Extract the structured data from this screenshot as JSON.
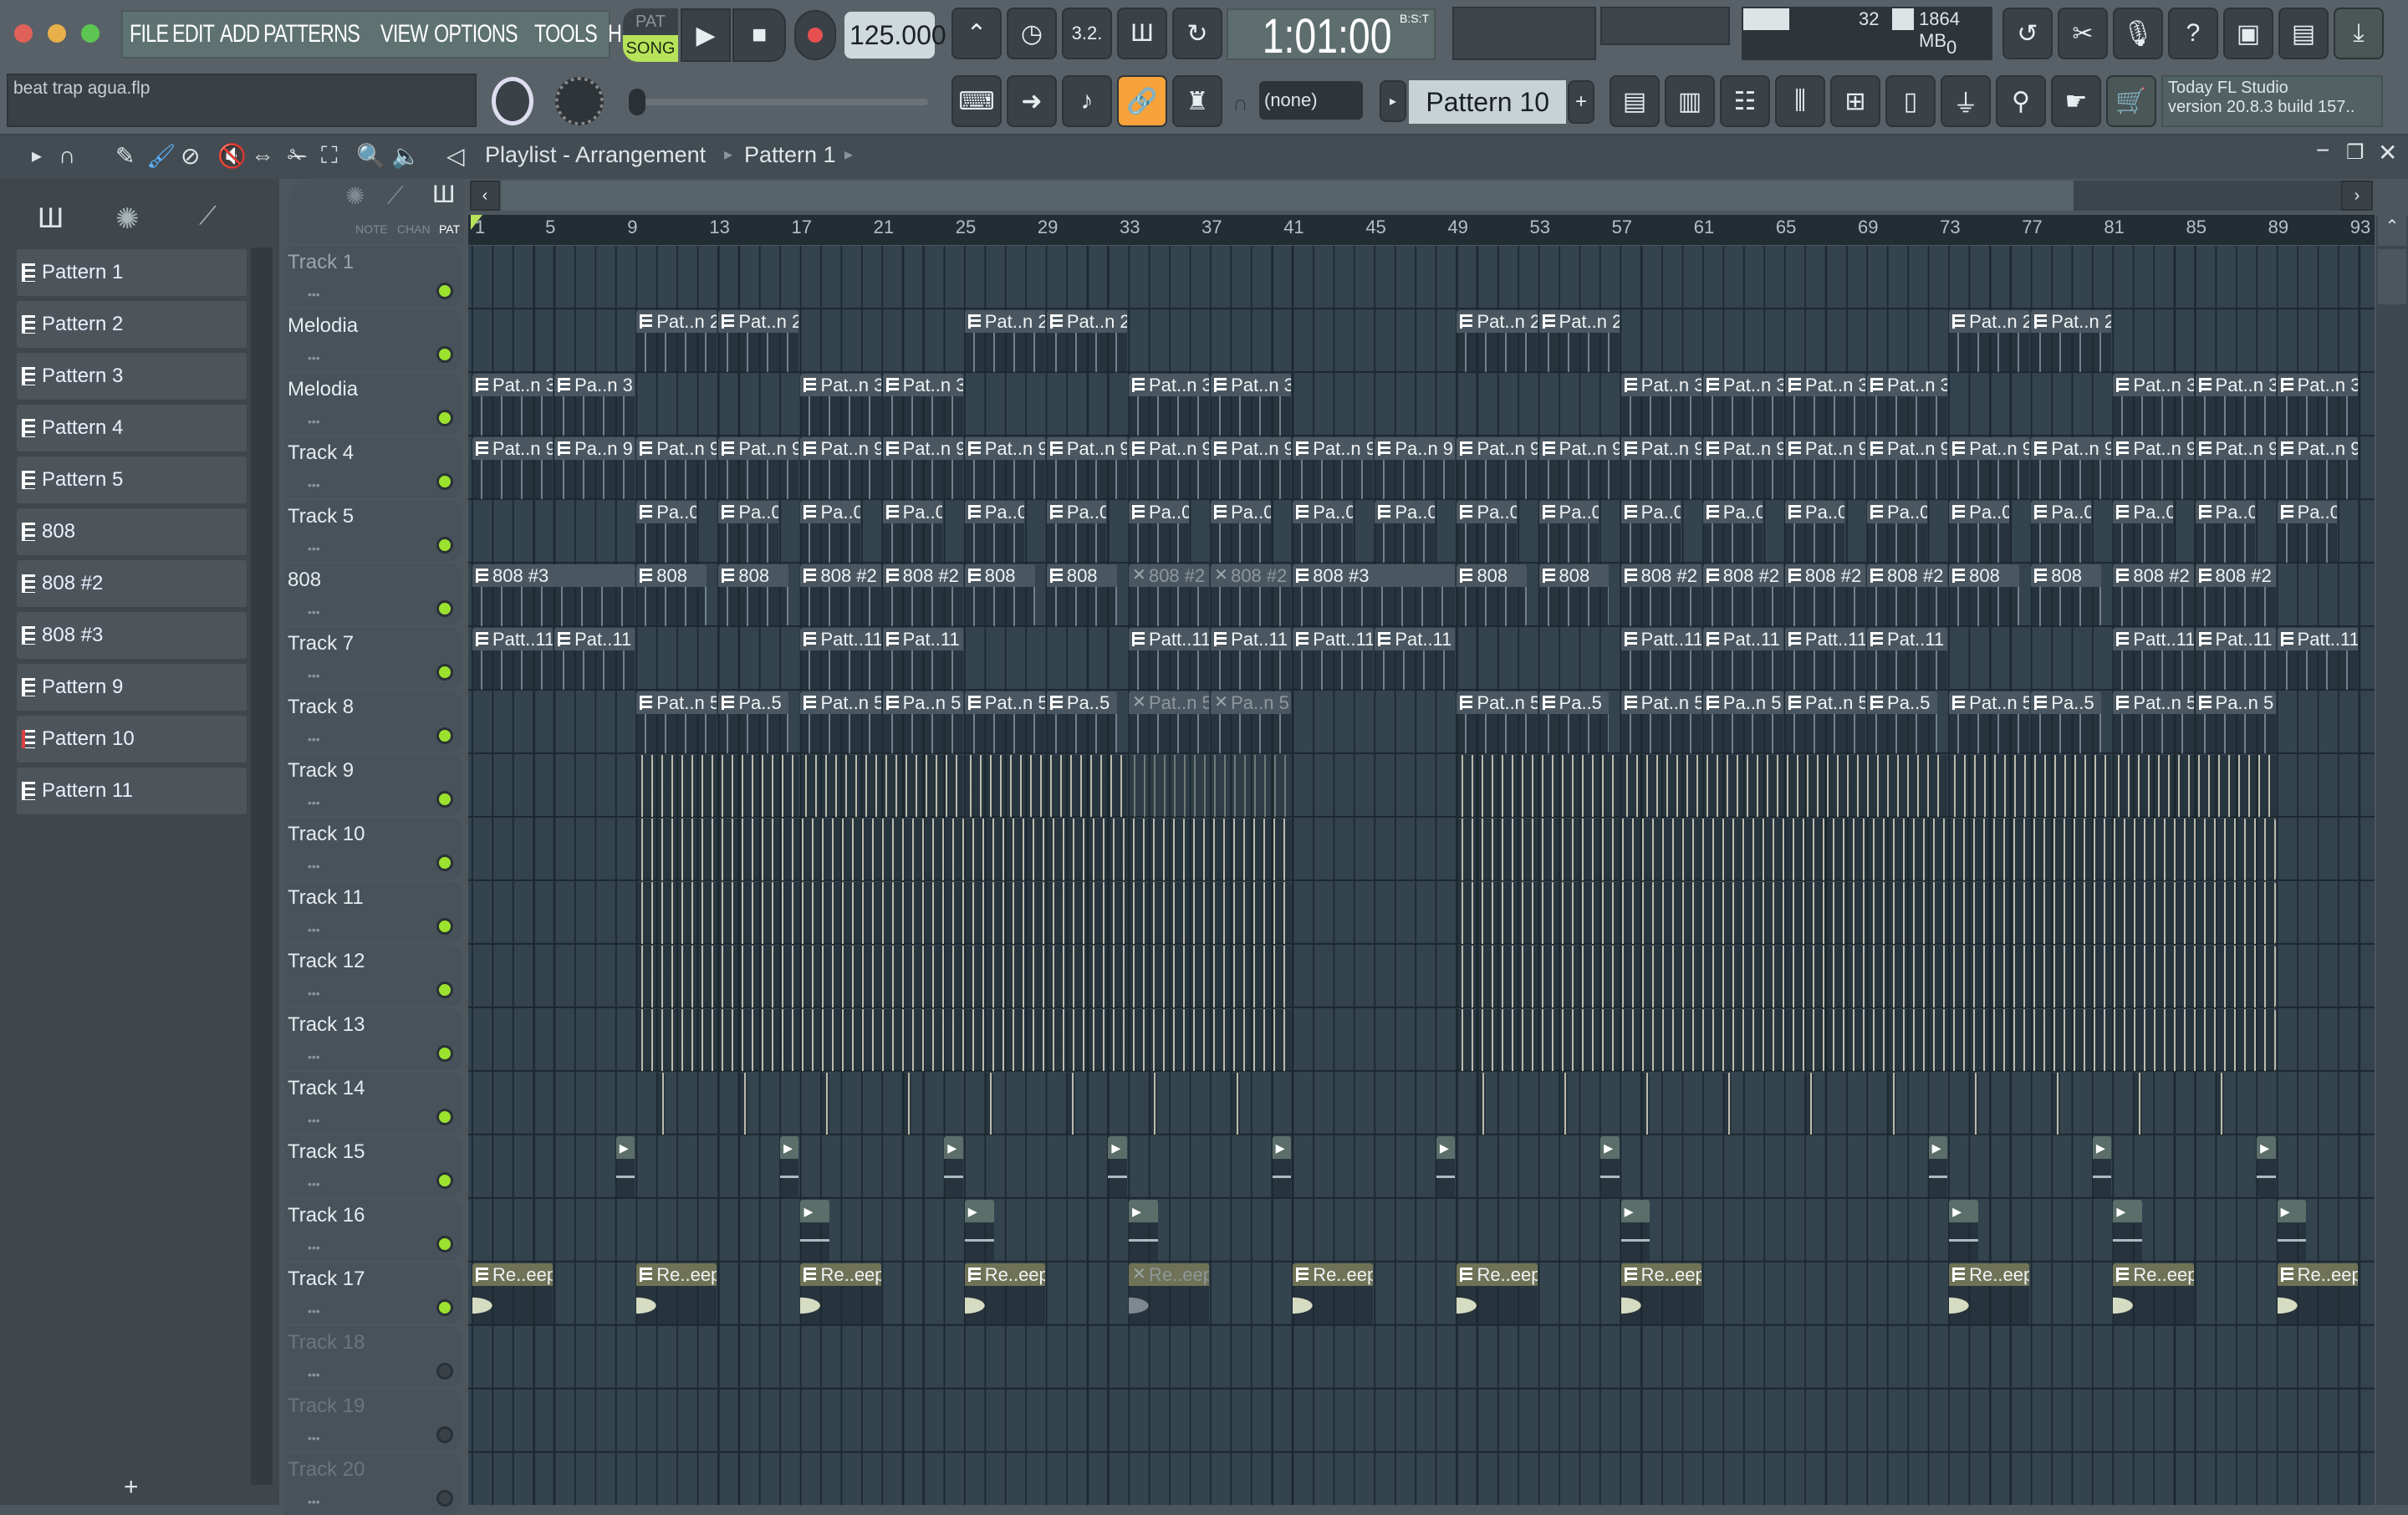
{
  "menu": [
    "FILE",
    "EDIT",
    "ADD",
    "PATTERNS",
    "VIEW",
    "OPTIONS",
    "TOOLS",
    "HELP"
  ],
  "transport": {
    "pat": "PAT",
    "song": "SONG",
    "tempo": "125.000",
    "time": "1:01:00",
    "time_format": "B:S:T"
  },
  "monitor": {
    "cpu": "32",
    "memory": "1864 MB",
    "polyphony": "0"
  },
  "project": {
    "filename": "beat trap agua.flp"
  },
  "pattern_selector": {
    "value": "Pattern 10",
    "add": "+",
    "snap": "(none)"
  },
  "hint": {
    "line1": "Today  FL Studio",
    "line2": "version 20.8.3 build 157.."
  },
  "playlist": {
    "title": "Playlist - Arrangement",
    "pattern": "Pattern 1",
    "tabs": [
      "NOTE",
      "CHAN",
      "PAT"
    ]
  },
  "picker": {
    "items": [
      "Pattern 1",
      "Pattern 2",
      "Pattern 3",
      "Pattern 4",
      "Pattern 5",
      "808",
      "808 #2",
      "808 #3",
      "Pattern 9",
      "Pattern 10",
      "Pattern 11"
    ],
    "selected": 9,
    "add": "+"
  },
  "ruler": [
    "1",
    "5",
    "9",
    "13",
    "17",
    "21",
    "25",
    "29",
    "33",
    "37",
    "41",
    "45",
    "49",
    "53",
    "57",
    "61",
    "65",
    "69",
    "73",
    "77",
    "81",
    "85",
    "89",
    "93"
  ],
  "colors": {
    "accent": "#f7a23b",
    "led": "#9be22f",
    "song": "#b6e35a"
  },
  "tracks": [
    {
      "name": "Track 1",
      "clips": []
    },
    {
      "name": "Melodia",
      "clips": [
        [
          9,
          4,
          "Pat..n 2"
        ],
        [
          13,
          4,
          "Pat..n 2"
        ],
        [
          25,
          4,
          "Pat..n 2"
        ],
        [
          29,
          4,
          "Pat..n 2"
        ],
        [
          49,
          4,
          "Pat..n 2"
        ],
        [
          53,
          4,
          "Pat..n 2"
        ],
        [
          73,
          4,
          "Pat..n 2"
        ],
        [
          77,
          4,
          "Pat..n 2"
        ]
      ]
    },
    {
      "name": "Melodia",
      "clips": [
        [
          1,
          4,
          "Pat..n 3"
        ],
        [
          5,
          4,
          "Pa..n 3"
        ],
        [
          17,
          4,
          "Pat..n 3"
        ],
        [
          21,
          4,
          "Pat..n 3"
        ],
        [
          33,
          4,
          "Pat..n 3"
        ],
        [
          37,
          4,
          "Pat..n 3"
        ],
        [
          57,
          4,
          "Pat..n 3"
        ],
        [
          61,
          4,
          "Pat..n 3"
        ],
        [
          65,
          4,
          "Pat..n 3"
        ],
        [
          69,
          4,
          "Pat..n 3"
        ],
        [
          81,
          4,
          "Pat..n 3"
        ],
        [
          85,
          4,
          "Pat..n 3"
        ],
        [
          89,
          4,
          "Pat..n 3"
        ]
      ]
    },
    {
      "name": "Track 4",
      "clips": [
        [
          1,
          4,
          "Pat..n 9"
        ],
        [
          5,
          4,
          "Pa..n 9"
        ],
        [
          9,
          4,
          "Pat..n 9"
        ],
        [
          13,
          4,
          "Pat..n 9"
        ],
        [
          17,
          4,
          "Pat..n 9"
        ],
        [
          21,
          4,
          "Pat..n 9"
        ],
        [
          25,
          4,
          "Pat..n 9"
        ],
        [
          29,
          4,
          "Pat..n 9"
        ],
        [
          33,
          4,
          "Pat..n 9"
        ],
        [
          37,
          4,
          "Pat..n 9"
        ],
        [
          41,
          4,
          "Pat..n 9"
        ],
        [
          45,
          4,
          "Pa..n 9"
        ],
        [
          49,
          4,
          "Pat..n 9"
        ],
        [
          53,
          4,
          "Pat..n 9"
        ],
        [
          57,
          4,
          "Pat..n 9"
        ],
        [
          61,
          4,
          "Pat..n 9"
        ],
        [
          65,
          4,
          "Pat..n 9"
        ],
        [
          69,
          4,
          "Pat..n 9"
        ],
        [
          73,
          4,
          "Pat..n 9"
        ],
        [
          77,
          4,
          "Pat..n 9"
        ],
        [
          81,
          4,
          "Pat..n 9"
        ],
        [
          85,
          4,
          "Pat..n 9"
        ],
        [
          89,
          4,
          "Pat..n 9"
        ]
      ]
    },
    {
      "name": "Track 5",
      "clips": [
        [
          9,
          3,
          "Pa..0"
        ],
        [
          13,
          3,
          "Pa..0"
        ],
        [
          17,
          3,
          "Pa..0"
        ],
        [
          21,
          3,
          "Pa..0"
        ],
        [
          25,
          3,
          "Pa..0"
        ],
        [
          29,
          3,
          "Pa..0"
        ],
        [
          33,
          3,
          "Pa..0"
        ],
        [
          37,
          3,
          "Pa..0"
        ],
        [
          41,
          3,
          "Pa..0"
        ],
        [
          45,
          3,
          "Pa..0"
        ],
        [
          49,
          3,
          "Pa..0"
        ],
        [
          53,
          3,
          "Pa..0"
        ],
        [
          57,
          3,
          "Pa..0"
        ],
        [
          61,
          3,
          "Pa..0"
        ],
        [
          65,
          3,
          "Pa..0"
        ],
        [
          69,
          3,
          "Pa..0"
        ],
        [
          73,
          3,
          "Pa..0"
        ],
        [
          77,
          3,
          "Pa..0"
        ],
        [
          81,
          3,
          "Pa..0"
        ],
        [
          85,
          3,
          "Pa..0"
        ],
        [
          89,
          3,
          "Pa..0"
        ]
      ]
    },
    {
      "name": "808",
      "clips": [
        [
          1,
          8,
          "808 #3"
        ],
        [
          9,
          3.5,
          "808"
        ],
        [
          13,
          3.5,
          "808"
        ],
        [
          17,
          4,
          "808 #2"
        ],
        [
          21,
          4,
          "808 #2"
        ],
        [
          25,
          3.5,
          "808"
        ],
        [
          29,
          3.5,
          "808"
        ],
        [
          33,
          4,
          "808 #2",
          1
        ],
        [
          37,
          4,
          "808 #2",
          1
        ],
        [
          41,
          8,
          "808 #3"
        ],
        [
          49,
          3.5,
          "808"
        ],
        [
          53,
          3.5,
          "808"
        ],
        [
          57,
          4,
          "808 #2"
        ],
        [
          61,
          4,
          "808 #2"
        ],
        [
          65,
          4,
          "808 #2"
        ],
        [
          69,
          4,
          "808 #2"
        ],
        [
          73,
          3.5,
          "808"
        ],
        [
          77,
          3.5,
          "808"
        ],
        [
          81,
          4,
          "808 #2"
        ],
        [
          85,
          4,
          "808 #2"
        ]
      ]
    },
    {
      "name": "Track 7",
      "clips": [
        [
          1,
          4,
          "Patt..11"
        ],
        [
          5,
          4,
          "Pat..11"
        ],
        [
          17,
          4,
          "Patt..11"
        ],
        [
          21,
          4,
          "Pat..11"
        ],
        [
          33,
          4,
          "Patt..11"
        ],
        [
          37,
          4,
          "Pat..11"
        ],
        [
          41,
          4,
          "Patt..11"
        ],
        [
          45,
          4,
          "Pat..11"
        ],
        [
          57,
          4,
          "Patt..11"
        ],
        [
          61,
          4,
          "Pat..11"
        ],
        [
          65,
          4,
          "Patt..11"
        ],
        [
          69,
          4,
          "Pat..11"
        ],
        [
          81,
          4,
          "Patt..11"
        ],
        [
          85,
          4,
          "Pat..11"
        ],
        [
          89,
          4,
          "Patt..11"
        ]
      ]
    },
    {
      "name": "Track 8",
      "clips": [
        [
          9,
          4,
          "Pat..n 5"
        ],
        [
          13,
          3.5,
          "Pa..5"
        ],
        [
          17,
          4,
          "Pat..n 5"
        ],
        [
          21,
          4,
          "Pa..n 5"
        ],
        [
          25,
          4,
          "Pat..n 5"
        ],
        [
          29,
          3.5,
          "Pa..5"
        ],
        [
          33,
          4,
          "Pat..n 5",
          1
        ],
        [
          37,
          4,
          "Pa..n 5",
          1
        ],
        [
          49,
          4,
          "Pat..n 5"
        ],
        [
          53,
          3.5,
          "Pa..5"
        ],
        [
          57,
          4,
          "Pat..n 5"
        ],
        [
          61,
          4,
          "Pa..n 5"
        ],
        [
          65,
          4,
          "Pat..n 5"
        ],
        [
          69,
          3.5,
          "Pa..5"
        ],
        [
          73,
          4,
          "Pat..n 5"
        ],
        [
          77,
          3.5,
          "Pa..5"
        ],
        [
          81,
          4,
          "Pat..n 5"
        ],
        [
          85,
          4,
          "Pa..n 5"
        ]
      ]
    },
    {
      "name": "Track 9",
      "hits": [
        [
          9,
          8
        ],
        [
          17,
          8
        ],
        [
          25,
          8
        ],
        [
          33,
          8,
          1
        ],
        [
          49,
          8
        ],
        [
          57,
          16
        ],
        [
          73,
          8
        ],
        [
          81,
          8
        ]
      ]
    },
    {
      "name": "Track 10",
      "hits": [
        [
          9,
          32
        ],
        [
          49,
          40
        ]
      ]
    },
    {
      "name": "Track 11",
      "hits": [
        [
          9,
          32
        ],
        [
          49,
          40
        ]
      ]
    },
    {
      "name": "Track 12",
      "hits": [
        [
          9,
          32
        ],
        [
          49,
          40
        ]
      ]
    },
    {
      "name": "Track 13",
      "hits": [
        [
          9,
          32
        ],
        [
          49,
          40
        ]
      ]
    },
    {
      "name": "Track 14",
      "hits": [
        [
          10,
          0.4
        ],
        [
          14,
          0.4
        ],
        [
          18,
          0.4
        ],
        [
          22,
          0.4
        ],
        [
          26,
          0.4
        ],
        [
          30,
          0.4
        ],
        [
          34,
          0.4
        ],
        [
          38,
          0.4
        ],
        [
          50,
          0.4
        ],
        [
          54,
          0.4
        ],
        [
          58,
          0.4
        ],
        [
          62,
          0.4
        ],
        [
          66,
          0.4
        ],
        [
          70,
          0.4
        ],
        [
          74,
          0.4
        ],
        [
          78,
          0.4
        ],
        [
          82,
          0.4
        ],
        [
          86,
          0.4
        ]
      ]
    },
    {
      "name": "Track 15",
      "audio": [
        8,
        16,
        24,
        32,
        40,
        48,
        56,
        72,
        80,
        88
      ]
    },
    {
      "name": "Track 16",
      "audio": [
        17,
        25,
        33,
        57,
        73,
        81,
        89
      ]
    },
    {
      "name": "Track 17",
      "clips": [
        [
          1,
          4,
          "Re..eep"
        ],
        [
          9,
          4,
          "Re..eep"
        ],
        [
          17,
          4,
          "Re..eep"
        ],
        [
          25,
          4,
          "Re..eep"
        ],
        [
          33,
          4,
          "Re..eep",
          1
        ],
        [
          41,
          4,
          "Re..eep"
        ],
        [
          49,
          4,
          "Re..eep"
        ],
        [
          57,
          4,
          "Re..eep"
        ],
        [
          73,
          4,
          "Re..eep"
        ],
        [
          81,
          4,
          "Re..eep"
        ],
        [
          89,
          4,
          "Re..eep"
        ]
      ],
      "wave": true
    },
    {
      "name": "Track 18",
      "empty": true
    },
    {
      "name": "Track 19",
      "empty": true
    },
    {
      "name": "Track 20",
      "empty": true
    }
  ]
}
